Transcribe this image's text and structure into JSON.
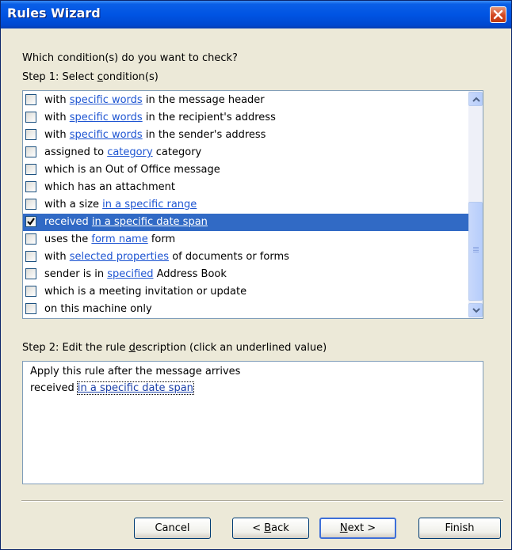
{
  "window": {
    "title": "Rules Wizard"
  },
  "prompt": "Which condition(s) do you want to check?",
  "step1": {
    "prefix": "Step 1: Select ",
    "accel": "c",
    "rest": "ondition(s)"
  },
  "conditions": [
    {
      "pre": "with ",
      "link": "specific words",
      "post": " in the message header",
      "checked": false,
      "selected": false
    },
    {
      "pre": "with ",
      "link": "specific words",
      "post": " in the recipient's address",
      "checked": false,
      "selected": false
    },
    {
      "pre": "with ",
      "link": "specific words",
      "post": " in the sender's address",
      "checked": false,
      "selected": false
    },
    {
      "pre": "assigned to ",
      "link": "category",
      "post": " category",
      "checked": false,
      "selected": false
    },
    {
      "pre": "which is an Out of Office message",
      "link": "",
      "post": "",
      "checked": false,
      "selected": false
    },
    {
      "pre": "which has an attachment",
      "link": "",
      "post": "",
      "checked": false,
      "selected": false
    },
    {
      "pre": "with a size ",
      "link": "in a specific range",
      "post": "",
      "checked": false,
      "selected": false
    },
    {
      "pre": "received ",
      "link": "in a specific date span",
      "post": "",
      "checked": true,
      "selected": true
    },
    {
      "pre": "uses the ",
      "link": "form name",
      "post": " form",
      "checked": false,
      "selected": false
    },
    {
      "pre": "with ",
      "link": "selected properties",
      "post": " of documents or forms",
      "checked": false,
      "selected": false
    },
    {
      "pre": "sender is in ",
      "link": "specified",
      "post": " Address Book",
      "checked": false,
      "selected": false
    },
    {
      "pre": "which is a meeting invitation or update",
      "link": "",
      "post": "",
      "checked": false,
      "selected": false
    },
    {
      "pre": "on this machine only",
      "link": "",
      "post": "",
      "checked": false,
      "selected": false
    }
  ],
  "step2": {
    "prefix": "Step 2: Edit the rule ",
    "accel": "d",
    "rest": "escription (click an underlined value)"
  },
  "description": {
    "line1": "Apply this rule after the message arrives",
    "line2_pre": "received ",
    "line2_link": "in a specific date span"
  },
  "buttons": {
    "cancel": "Cancel",
    "back_pre": "< ",
    "back_accel": "B",
    "back_rest": "ack",
    "next_accel": "N",
    "next_rest": "ext >",
    "finish": "Finish"
  },
  "colors": {
    "title_bar": "#0054e3",
    "selection": "#316ac5",
    "link": "#1e55d2",
    "dialog_bg": "#ece9d8"
  },
  "icons": {
    "close": "close-icon",
    "scroll_up": "arrow-up-icon",
    "scroll_down": "arrow-down-icon",
    "check": "checkmark-icon"
  }
}
